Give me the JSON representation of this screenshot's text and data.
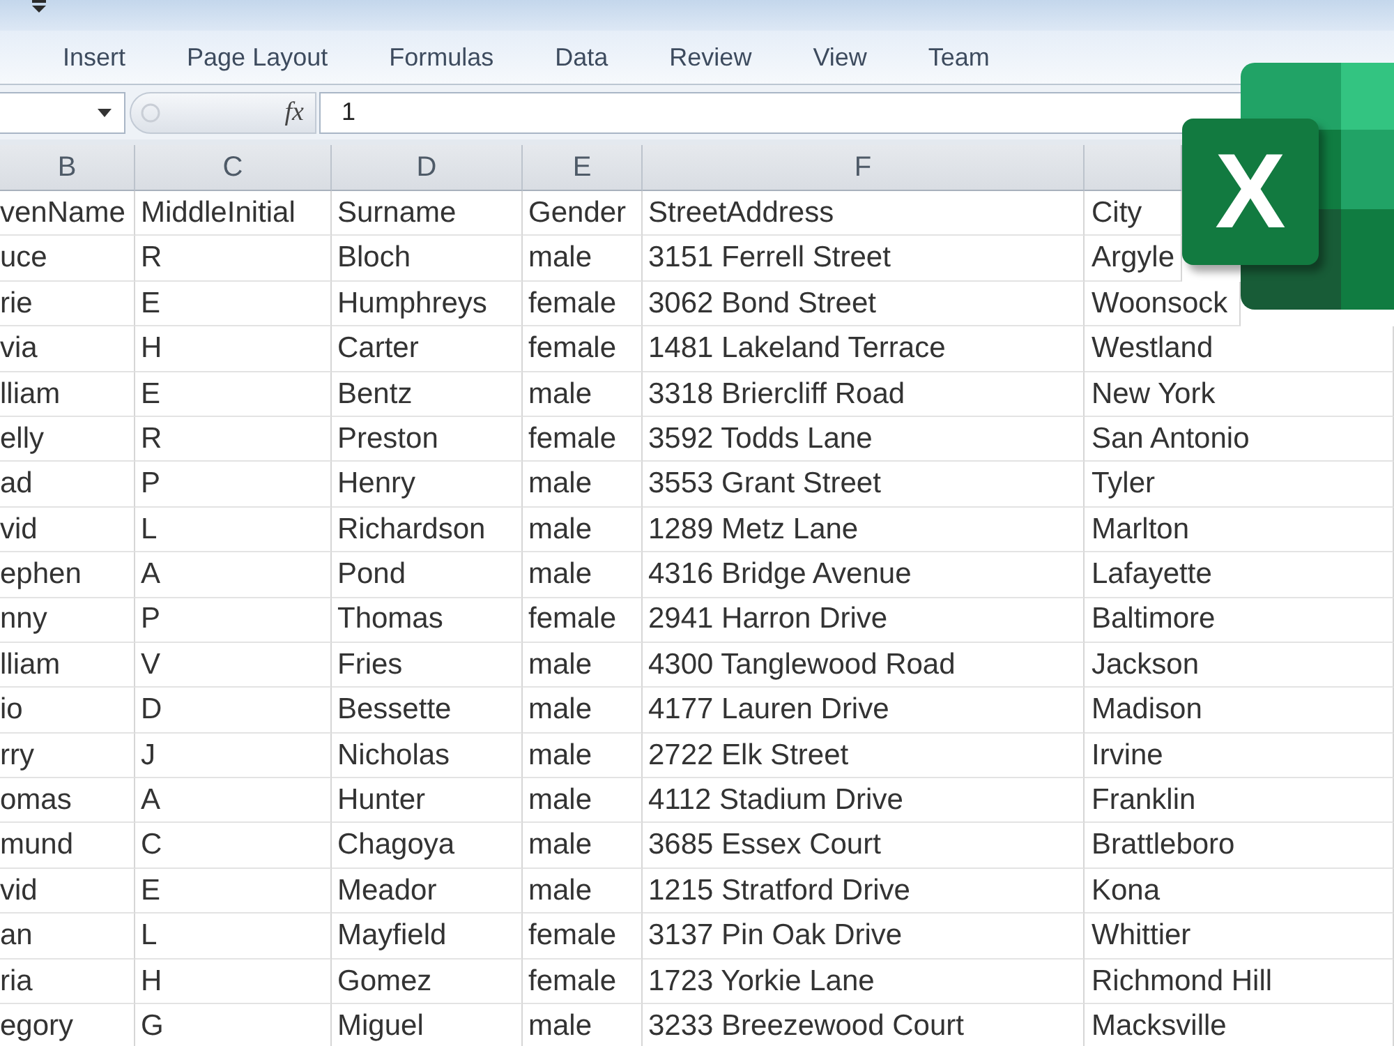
{
  "ribbon": {
    "tabs": [
      {
        "label": "Insert",
        "selected": false
      },
      {
        "label": "Page Layout",
        "selected": false
      },
      {
        "label": "Formulas",
        "selected": false
      },
      {
        "label": "Data",
        "selected": false
      },
      {
        "label": "Review",
        "selected": false
      },
      {
        "label": "View",
        "selected": false
      },
      {
        "label": "Team",
        "selected": false
      }
    ]
  },
  "formula_bar": {
    "function_button": "fx",
    "value": "1"
  },
  "sheet": {
    "column_letters": [
      "B",
      "C",
      "D",
      "E",
      "F"
    ],
    "rows": [
      [
        "venName",
        "MiddleInitial",
        "Surname",
        "Gender",
        "StreetAddress",
        "City"
      ],
      [
        "uce",
        "R",
        "Bloch",
        "male",
        "3151 Ferrell Street",
        "Argyle"
      ],
      [
        "rie",
        "E",
        "Humphreys",
        "female",
        "3062 Bond Street",
        "Woonsock"
      ],
      [
        "via",
        "H",
        "Carter",
        "female",
        "1481 Lakeland Terrace",
        "Westland"
      ],
      [
        "lliam",
        "E",
        "Bentz",
        "male",
        "3318 Briercliff Road",
        "New York"
      ],
      [
        "elly",
        "R",
        "Preston",
        "female",
        "3592 Todds Lane",
        "San Antonio"
      ],
      [
        "ad",
        "P",
        "Henry",
        "male",
        "3553 Grant Street",
        "Tyler"
      ],
      [
        "vid",
        "L",
        "Richardson",
        "male",
        "1289 Metz Lane",
        "Marlton"
      ],
      [
        "ephen",
        "A",
        "Pond",
        "male",
        "4316 Bridge Avenue",
        "Lafayette"
      ],
      [
        "nny",
        "P",
        "Thomas",
        "female",
        "2941 Harron Drive",
        "Baltimore"
      ],
      [
        "lliam",
        "V",
        "Fries",
        "male",
        "4300 Tanglewood Road",
        "Jackson"
      ],
      [
        "io",
        "D",
        "Bessette",
        "male",
        "4177 Lauren Drive",
        "Madison"
      ],
      [
        "rry",
        "J",
        "Nicholas",
        "male",
        "2722 Elk Street",
        "Irvine"
      ],
      [
        "omas",
        "A",
        "Hunter",
        "male",
        "4112 Stadium Drive",
        "Franklin"
      ],
      [
        "mund",
        "C",
        "Chagoya",
        "male",
        "3685 Essex Court",
        "Brattleboro"
      ],
      [
        "vid",
        "E",
        "Meador",
        "male",
        "1215 Stratford Drive",
        "Kona"
      ],
      [
        "an",
        "L",
        "Mayfield",
        "female",
        "3137 Pin Oak Drive",
        "Whittier"
      ],
      [
        "ria",
        "H",
        "Gomez",
        "female",
        "1723 Yorkie Lane",
        "Richmond Hill"
      ],
      [
        "egory",
        "G",
        "Miguel",
        "male",
        "3233 Breezewood Court",
        "Macksville"
      ]
    ]
  },
  "app_logo": {
    "letter": "X"
  }
}
